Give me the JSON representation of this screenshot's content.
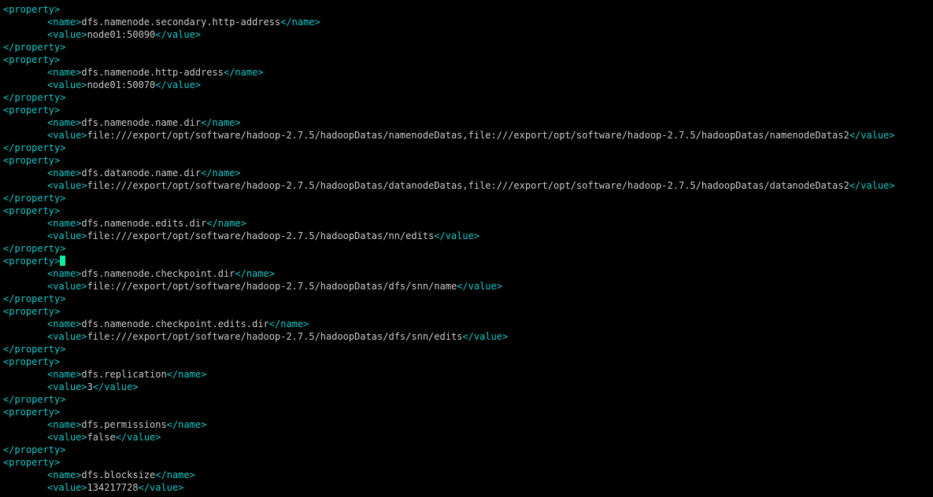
{
  "tags": {
    "prop_open": "<property>",
    "prop_close": "</property>",
    "name_open": "<name>",
    "name_close": "</name>",
    "value_open": "<value>",
    "value_close": "</value>"
  },
  "properties": [
    {
      "name": "dfs.namenode.secondary.http-address",
      "value": "node01:50090",
      "cursor_after_open": false
    },
    {
      "name": "dfs.namenode.http-address",
      "value": "node01:50070",
      "cursor_after_open": false
    },
    {
      "name": "dfs.namenode.name.dir",
      "value": "file:///export/opt/software/hadoop-2.7.5/hadoopDatas/namenodeDatas,file:///export/opt/software/hadoop-2.7.5/hadoopDatas/namenodeDatas2",
      "cursor_after_open": false
    },
    {
      "name": "dfs.datanode.name.dir",
      "value": "file:///export/opt/software/hadoop-2.7.5/hadoopDatas/datanodeDatas,file:///export/opt/software/hadoop-2.7.5/hadoopDatas/datanodeDatas2",
      "cursor_after_open": false
    },
    {
      "name": "dfs.namenode.edits.dir",
      "value": "file:///export/opt/software/hadoop-2.7.5/hadoopDatas/nn/edits",
      "cursor_after_open": false
    },
    {
      "name": "dfs.namenode.checkpoint.dir",
      "value": "file:///export/opt/software/hadoop-2.7.5/hadoopDatas/dfs/snn/name",
      "cursor_after_open": true
    },
    {
      "name": "dfs.namenode.checkpoint.edits.dir",
      "value": "file:///export/opt/software/hadoop-2.7.5/hadoopDatas/dfs/snn/edits",
      "cursor_after_open": false
    },
    {
      "name": "dfs.replication",
      "value": "3",
      "cursor_after_open": false
    },
    {
      "name": "dfs.permissions",
      "value": "false",
      "cursor_after_open": false
    },
    {
      "name": "dfs.blocksize",
      "value": "134217728",
      "cursor_after_open": false,
      "no_close": true
    }
  ]
}
